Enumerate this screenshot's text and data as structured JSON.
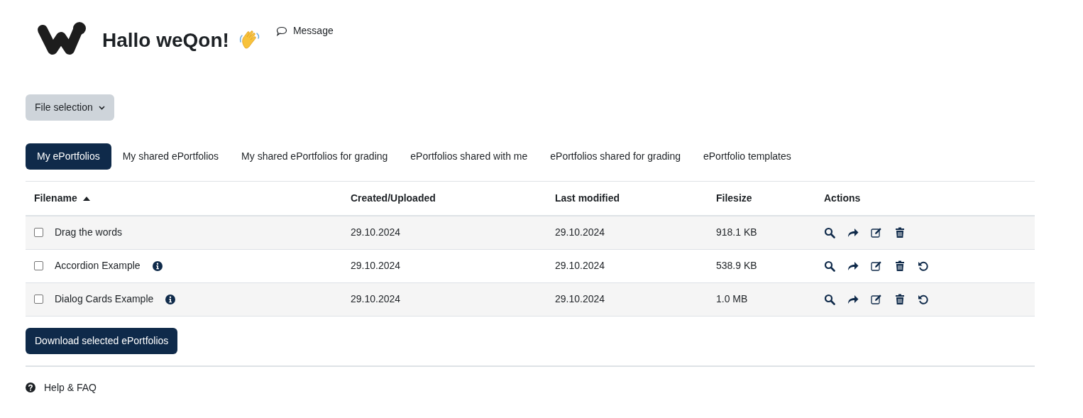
{
  "header": {
    "greeting": "Hallo weQon!",
    "message_link": "Message"
  },
  "file_selection": {
    "label": "File selection"
  },
  "tabs": [
    {
      "label": "My ePortfolios",
      "selected": true
    },
    {
      "label": "My shared ePortfolios",
      "selected": false
    },
    {
      "label": "My shared ePortfolios for grading",
      "selected": false
    },
    {
      "label": "ePortfolios shared with me",
      "selected": false
    },
    {
      "label": "ePortfolios shared for grading",
      "selected": false
    },
    {
      "label": "ePortfolio templates",
      "selected": false
    }
  ],
  "table": {
    "columns": [
      {
        "label": "Filename",
        "sorted": true
      },
      {
        "label": "Created/Uploaded",
        "sorted": false
      },
      {
        "label": "Last modified",
        "sorted": false
      },
      {
        "label": "Filesize",
        "sorted": false
      },
      {
        "label": "Actions",
        "sorted": false
      }
    ],
    "rows": [
      {
        "checked": false,
        "filename": "Drag the words",
        "info": false,
        "created": "29.10.2024",
        "modified": "29.10.2024",
        "size": "918.1 KB",
        "actions": [
          {
            "kind": "view"
          },
          {
            "kind": "share"
          },
          {
            "kind": "edit"
          },
          {
            "kind": "delete"
          }
        ]
      },
      {
        "checked": false,
        "filename": "Accordion Example",
        "info": true,
        "created": "29.10.2024",
        "modified": "29.10.2024",
        "size": "538.9 KB",
        "actions": [
          {
            "kind": "view"
          },
          {
            "kind": "share"
          },
          {
            "kind": "edit"
          },
          {
            "kind": "delete"
          },
          {
            "kind": "restore"
          }
        ]
      },
      {
        "checked": false,
        "filename": "Dialog Cards Example",
        "info": true,
        "created": "29.10.2024",
        "modified": "29.10.2024",
        "size": "1.0 MB",
        "actions": [
          {
            "kind": "view"
          },
          {
            "kind": "share"
          },
          {
            "kind": "edit"
          },
          {
            "kind": "delete"
          },
          {
            "kind": "restore"
          }
        ]
      }
    ]
  },
  "download_button": "Download selected ePortfolios",
  "footer": {
    "help_link": "Help & FAQ"
  }
}
